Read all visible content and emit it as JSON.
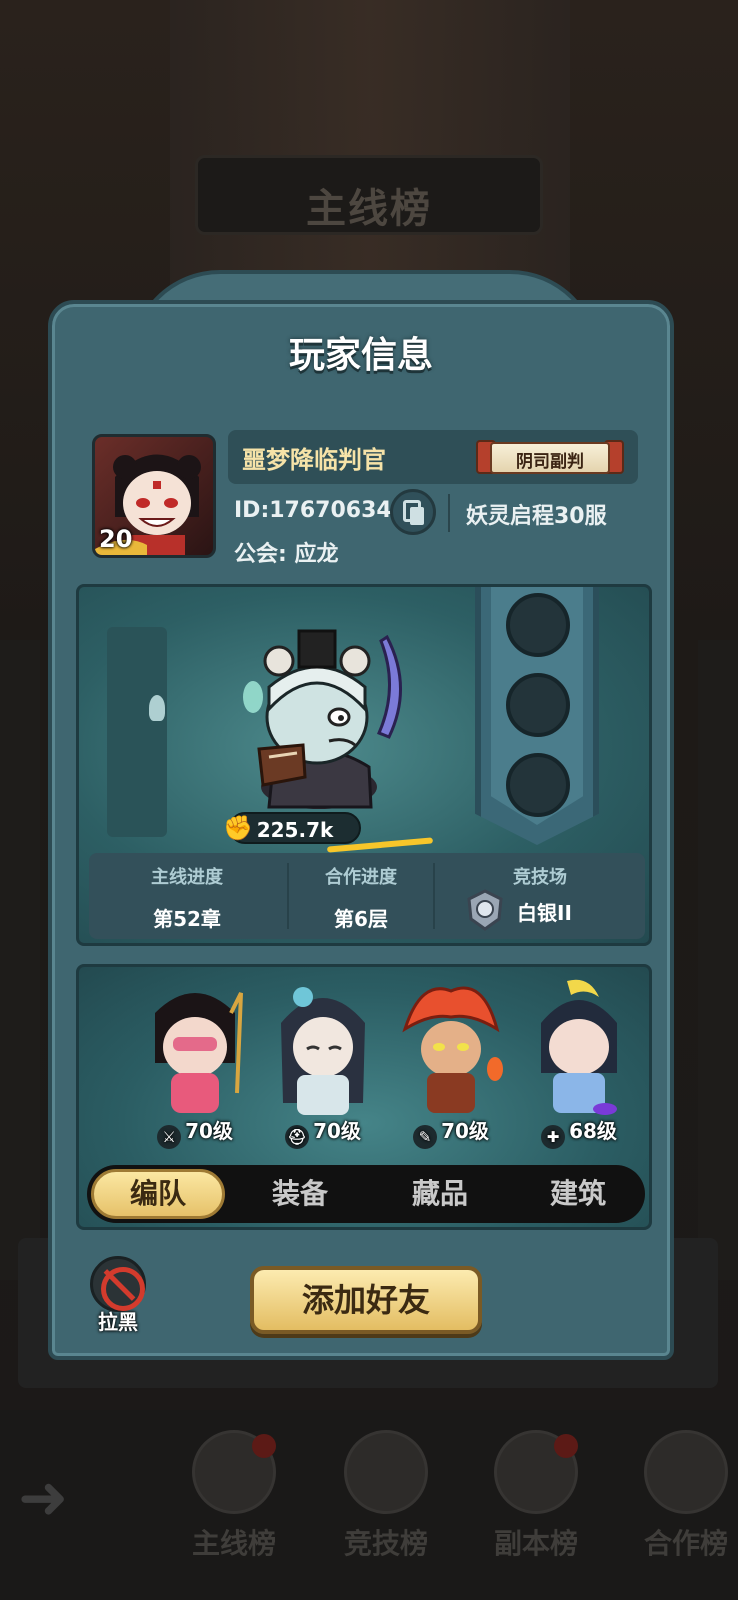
{
  "background": {
    "ranking_title": "主线榜"
  },
  "bottom_nav": {
    "tabs": [
      {
        "label": "主线榜",
        "has_dot": true
      },
      {
        "label": "竞技榜",
        "has_dot": false
      },
      {
        "label": "副本榜",
        "has_dot": true
      },
      {
        "label": "合作榜",
        "has_dot": false
      }
    ]
  },
  "panel": {
    "title": "玩家信息",
    "player": {
      "name": "噩梦降临判官",
      "title_badge": "阴司副判",
      "level": "20",
      "id": "ID:17670634",
      "server": "妖灵启程30服",
      "guild": "公会: 应龙"
    },
    "showcase": {
      "power": "225.7k",
      "empty_slots": 3
    },
    "stats": [
      {
        "label": "主线进度",
        "value": "第52章"
      },
      {
        "label": "合作进度",
        "value": "第6层"
      },
      {
        "label": "竞技场",
        "value": "白银II"
      }
    ],
    "team": [
      {
        "class_icon": "sword-class-icon",
        "level": "70级",
        "color": "#e85a7c"
      },
      {
        "class_icon": "helmet-class-icon",
        "level": "70级",
        "color": "#d8e6ea"
      },
      {
        "class_icon": "staff-class-icon",
        "level": "70级",
        "color": "#e8502e"
      },
      {
        "class_icon": "heal-class-icon",
        "level": "68级",
        "color": "#8bb6e8"
      }
    ],
    "tabs": [
      "编队",
      "装备",
      "藏品",
      "建筑"
    ],
    "active_tab": "编队",
    "block_label": "拉黑",
    "add_friend_label": "添加好友"
  },
  "colors": {
    "panel": "#3f6670",
    "accent_gold": "#f7c62a",
    "button_gold": "#e3bd62",
    "name_text": "#f6e3a8"
  }
}
